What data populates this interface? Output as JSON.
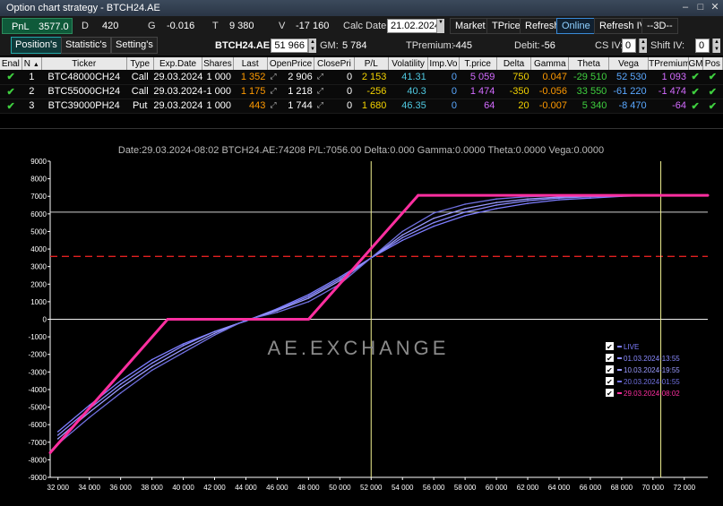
{
  "window": {
    "title": "Option chart strategy - BTCH24.AE"
  },
  "toolbar": {
    "pnl_label": "PnL",
    "pnl_value": "3577.0",
    "d_label": "D",
    "d_value": "420",
    "g_label": "G",
    "g_value": "-0.016",
    "t_label": "T",
    "t_value": "9 380",
    "v_label": "V",
    "v_value": "-17 160",
    "calc_date_label": "Calc Date:",
    "calc_date_value": "21.02.2024",
    "market": "Market",
    "tprice": "TPrice",
    "refresh": "Refresh",
    "online": "Online",
    "refresh_iv": "Refresh IV",
    "period": "--3D--"
  },
  "subbar": {
    "tab_positions": "Position's",
    "tab_statistics": "Statistic's",
    "tab_settings": "Setting's",
    "underlying": "BTCH24.AE",
    "underlying_price": "51 966",
    "gm_label": "GM:",
    "gm_value": "5 784",
    "tpremium_label": "TPremium:",
    "tpremium_value": "-445",
    "debit_label": "Debit:",
    "debit_value": "-56",
    "cs_iv_label": "CS IV:",
    "cs_iv_value": "0",
    "shift_iv_label": "Shift IV:",
    "shift_iv_value": "0"
  },
  "table": {
    "headers": [
      "Enal",
      "N",
      "Ticker",
      "Type",
      "Exp.Date",
      "Shares",
      "Last",
      "OpenPrice",
      "ClosePri",
      "P/L",
      "Volatility",
      "Imp.Vo",
      "T.price",
      "Delta",
      "Gamma",
      "Theta",
      "Vega",
      "TPremium",
      "GM",
      "Pos"
    ],
    "sort_indicator": "▲",
    "rows": [
      {
        "n": "1",
        "ticker": "BTC48000CH24",
        "type": "Call",
        "exp": "29.03.2024",
        "shares": "1 000",
        "last": "1 352",
        "open": "2 906",
        "close": "0",
        "pl": "2 153",
        "vol": "41.31",
        "impvol": "0",
        "tprice": "5 059",
        "delta": "750",
        "gamma": "0.047",
        "theta": "-29 510",
        "vega": "52 530",
        "tprem": "1 093"
      },
      {
        "n": "2",
        "ticker": "BTC55000CH24",
        "type": "Call",
        "exp": "29.03.2024",
        "shares": "-1 000",
        "last": "1 175",
        "open": "1 218",
        "close": "0",
        "pl": "-256",
        "vol": "40.3",
        "impvol": "0",
        "tprice": "1 474",
        "delta": "-350",
        "gamma": "-0.056",
        "theta": "33 550",
        "vega": "-61 220",
        "tprem": "-1 474"
      },
      {
        "n": "3",
        "ticker": "BTC39000PH24",
        "type": "Put",
        "exp": "29.03.2024",
        "shares": "1 000",
        "last": "443",
        "open": "1 744",
        "close": "0",
        "pl": "1 680",
        "vol": "46.35",
        "impvol": "0",
        "tprice": "64",
        "delta": "20",
        "gamma": "-0.007",
        "theta": "5 340",
        "vega": "-8 470",
        "tprem": "-64"
      }
    ]
  },
  "chart_header": "Date:29.03.2024-08:02  BTCH24.AE:74208  P/L:7056.00  Delta:0.000  Gamma:0.0000  Theta:0.0000  Vega:0.0000",
  "watermark": "AE.EXCHANGE",
  "colors": {
    "live": "#7d7dff",
    "d1": "#8a8aff",
    "d2": "#9a9aff",
    "d3": "#7070e0",
    "expiry": "#ff2fa0",
    "vline": "#f0f090",
    "hline": "#d0d0d0",
    "dashed": "#e02020",
    "axis": "#ffffff"
  },
  "chart_data": {
    "type": "line",
    "title": "",
    "xlabel": "",
    "ylabel": "",
    "xlim": [
      31500,
      73500
    ],
    "ylim": [
      -9000,
      9000
    ],
    "x_ticks": [
      32000,
      34000,
      36000,
      38000,
      40000,
      42000,
      44000,
      46000,
      48000,
      50000,
      52000,
      54000,
      56000,
      58000,
      60000,
      62000,
      64000,
      66000,
      68000,
      70000,
      72000
    ],
    "x_tick_labels": [
      "32 000",
      "34 000",
      "36 000",
      "38 000",
      "40 000",
      "42 000",
      "44 000",
      "46 000",
      "48 000",
      "50 000",
      "52 000",
      "54 000",
      "56 000",
      "58 000",
      "60 000",
      "62 000",
      "64 000",
      "66 000",
      "68 000",
      "70 000",
      "72 000"
    ],
    "y_ticks": [
      -9000,
      -8000,
      -7000,
      -6000,
      -5000,
      -4000,
      -3000,
      -2000,
      -1000,
      0,
      1000,
      2000,
      3000,
      4000,
      5000,
      6000,
      7000,
      8000,
      9000
    ],
    "y_tick_labels": [
      "-9000",
      "-8000",
      "-7000",
      "-6000",
      "-5000",
      "-4000",
      "-3000",
      "-2000",
      "-1000",
      "0",
      "1000",
      "2000",
      "3000",
      "4000",
      "5000",
      "6000",
      "7000",
      "8000",
      "9000"
    ],
    "reference_lines": {
      "vertical_x": 52000,
      "right_vertical_x": 70500,
      "horizontal_y": 6100,
      "dashed_y": 3577
    },
    "legend_position": "bottom-right",
    "series": [
      {
        "name": "LIVE",
        "color": "#7d7dff",
        "x": [
          32000,
          34000,
          36000,
          38000,
          40000,
          42000,
          44000,
          46000,
          48000,
          50000,
          52000,
          54000,
          56000,
          58000,
          60000,
          62000,
          64000,
          66000,
          68000,
          70000
        ],
        "y": [
          -6400,
          -4900,
          -3500,
          -2300,
          -1400,
          -700,
          -100,
          600,
          1400,
          2400,
          3500,
          4500,
          5300,
          5900,
          6300,
          6600,
          6800,
          6900,
          7000,
          7050
        ]
      },
      {
        "name": "01.03.2024-13:55",
        "color": "#8a8aff",
        "x": [
          32000,
          34000,
          36000,
          38000,
          40000,
          42000,
          44000,
          46000,
          48000,
          50000,
          52000,
          54000,
          56000,
          58000,
          60000,
          62000,
          64000,
          66000,
          68000,
          70000
        ],
        "y": [
          -6600,
          -5100,
          -3700,
          -2500,
          -1500,
          -700,
          -80,
          550,
          1300,
          2300,
          3500,
          4650,
          5500,
          6100,
          6500,
          6750,
          6900,
          6980,
          7030,
          7050
        ]
      },
      {
        "name": "10.03.2024-19:55",
        "color": "#9a9aff",
        "x": [
          32000,
          34000,
          36000,
          38000,
          40000,
          42000,
          44000,
          46000,
          48000,
          50000,
          52000,
          54000,
          56000,
          58000,
          60000,
          62000,
          64000,
          66000,
          68000,
          70000
        ],
        "y": [
          -6800,
          -5300,
          -3900,
          -2700,
          -1700,
          -800,
          -60,
          500,
          1200,
          2200,
          3500,
          4800,
          5750,
          6300,
          6650,
          6850,
          6960,
          7020,
          7040,
          7050
        ]
      },
      {
        "name": "20.03.2024-01:55",
        "color": "#7070e0",
        "x": [
          32000,
          34000,
          36000,
          38000,
          40000,
          42000,
          44000,
          46000,
          48000,
          50000,
          52000,
          54000,
          56000,
          58000,
          60000,
          62000,
          64000,
          66000,
          68000,
          70000
        ],
        "y": [
          -7100,
          -5600,
          -4200,
          -2900,
          -1900,
          -900,
          -40,
          400,
          1000,
          2000,
          3500,
          5000,
          6050,
          6550,
          6850,
          6980,
          7030,
          7050,
          7056,
          7056
        ]
      },
      {
        "name": "29.03.2024-08:02",
        "color": "#ff2fa0",
        "x": [
          31500,
          39000,
          48000,
          55000,
          73500
        ],
        "y": [
          -7600,
          0,
          0,
          7056,
          7056
        ]
      }
    ]
  }
}
